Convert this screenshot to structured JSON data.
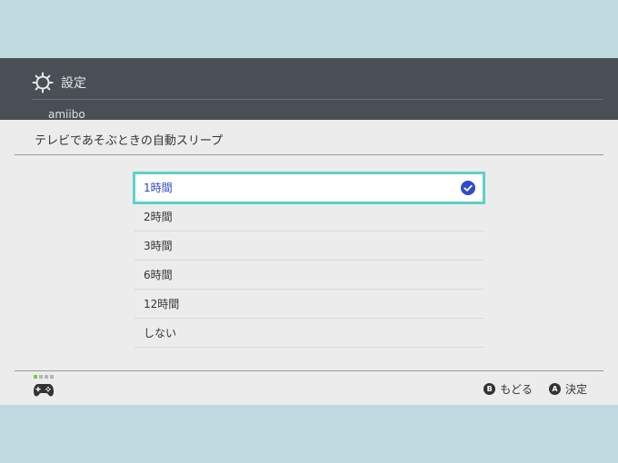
{
  "header": {
    "title": "設定",
    "subtitle": "amiibo"
  },
  "dialog": {
    "title": "テレビであそぶときの自動スリープ",
    "options": [
      {
        "label": "1時間",
        "selected": true
      },
      {
        "label": "2時間"
      },
      {
        "label": "3時間"
      },
      {
        "label": "6時間"
      },
      {
        "label": "12時間"
      },
      {
        "label": "しない"
      }
    ]
  },
  "footer": {
    "back_key": "B",
    "back_label": "もどる",
    "confirm_key": "A",
    "confirm_label": "決定"
  },
  "colors": {
    "selection_outline": "#5ed1c8",
    "selected_text": "#2a46c9",
    "checkmark": "#2d4bd1",
    "header_bg": "#4a4f55",
    "dialog_bg": "#ececec",
    "backdrop": "#bfd9e1"
  },
  "icons": {
    "header": "gear-icon",
    "check": "checkmark-circle-icon",
    "controller": "gamepad-icon"
  }
}
